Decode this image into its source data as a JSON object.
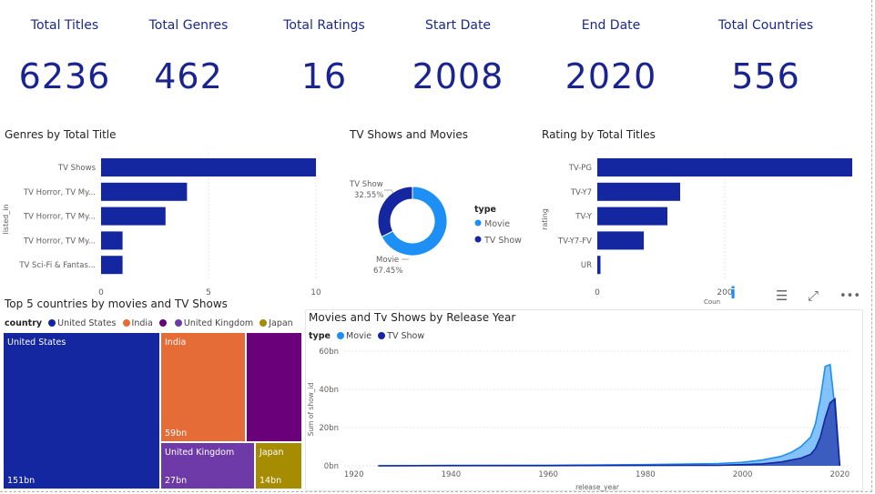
{
  "kpis": [
    {
      "label": "Total Titles",
      "value": "6236"
    },
    {
      "label": "Total Genres",
      "value": "462"
    },
    {
      "label": "Total Ratings",
      "value": "16"
    },
    {
      "label": "Start Date",
      "value": "2008"
    },
    {
      "label": "End Date",
      "value": "2020"
    },
    {
      "label": "Total Countries",
      "value": "556"
    }
  ],
  "colors": {
    "navy": "#1427a0",
    "blue": "#1e8ff5",
    "orange": "#e66c37",
    "purple": "#6b007b",
    "violet": "#6e3aa7",
    "olive": "#a68c00"
  },
  "toolbar": {
    "info_icon": "info-icon",
    "filter_icon": "filter-icon",
    "focus_icon": "focus-mode-icon",
    "more_icon": "more-options-icon"
  },
  "chart_data": [
    {
      "type": "bar",
      "orientation": "horizontal",
      "title": "Genres by Total Title",
      "ylabel": "listed_in",
      "xlabel": "",
      "categories": [
        "TV Shows",
        "TV Horror, TV My...",
        "TV Horror, TV My...",
        "TV Horror, TV My...",
        "TV Sci-Fi & Fantas..."
      ],
      "values": [
        10,
        4,
        3,
        1,
        1
      ],
      "xticks": [
        "0",
        "5",
        "10"
      ],
      "xlim": [
        0,
        10
      ],
      "grid": true
    },
    {
      "type": "pie",
      "donut": true,
      "title": "TV Shows and Movies",
      "legend_title": "type",
      "legend_position": "right",
      "categories": [
        "Movie",
        "TV Show"
      ],
      "values": [
        67.45,
        32.55
      ],
      "labels": [
        "Movie",
        "TV Show"
      ],
      "percent_labels": [
        "67.45%",
        "32.55%"
      ]
    },
    {
      "type": "bar",
      "orientation": "horizontal",
      "title": "Rating by Total Titles",
      "ylabel": "rating",
      "xlabel": "Coun",
      "categories": [
        "TV-PG",
        "TV-Y7",
        "TV-Y",
        "TV-Y7-FV",
        "UR"
      ],
      "values": [
        400,
        130,
        110,
        73,
        5
      ],
      "xticks": [
        "0",
        "200"
      ],
      "xlim": [
        0,
        400
      ],
      "grid": true
    },
    {
      "type": "treemap",
      "title": "Top 5 countries by movies and TV Shows",
      "legend_title": "country",
      "legend_position": "top-left",
      "legend": [
        "United States",
        "India",
        "",
        "United Kingdom",
        "Japan"
      ],
      "cells": [
        {
          "name": "United States",
          "label": "United States",
          "value": "151bn",
          "value_num": 151
        },
        {
          "name": "India",
          "label": "India",
          "value": "59bn",
          "value_num": 59
        },
        {
          "name": "",
          "label": "",
          "value": "",
          "value_num": 43
        },
        {
          "name": "United Kingdom",
          "label": "United Kingdom",
          "value": "27bn",
          "value_num": 27
        },
        {
          "name": "Japan",
          "label": "Japan",
          "value": "14bn",
          "value_num": 14
        }
      ]
    },
    {
      "type": "area",
      "stacked": false,
      "title": "Movies and Tv Shows by Release Year",
      "xlabel": "release_year",
      "ylabel": "Sum of show_id",
      "legend_title": "type",
      "legend_position": "top-left",
      "xlim": [
        1918,
        2022
      ],
      "ylim": [
        0,
        60
      ],
      "xticks": [
        1920,
        1940,
        1960,
        1980,
        2000,
        2020
      ],
      "yticks": [
        "0bn",
        "20bn",
        "40bn",
        "60bn"
      ],
      "grid": true,
      "series": [
        {
          "name": "Movie",
          "x": [
            1925,
            1940,
            1960,
            1980,
            1995,
            2000,
            2004,
            2008,
            2010,
            2012,
            2014,
            2015,
            2016,
            2017,
            2018,
            2019,
            2020
          ],
          "y": [
            0,
            0.2,
            0.3,
            0.6,
            1.2,
            1.8,
            3,
            5,
            7,
            10,
            15,
            22,
            35,
            52,
            53,
            30,
            0
          ]
        },
        {
          "name": "TV Show",
          "x": [
            1925,
            1940,
            1960,
            1980,
            1995,
            2000,
            2004,
            2008,
            2010,
            2012,
            2014,
            2015,
            2016,
            2017,
            2018,
            2019,
            2020
          ],
          "y": [
            0,
            0.1,
            0.1,
            0.2,
            0.3,
            0.6,
            1,
            2,
            3,
            4,
            6,
            9,
            15,
            25,
            33,
            35,
            0
          ]
        }
      ]
    }
  ]
}
